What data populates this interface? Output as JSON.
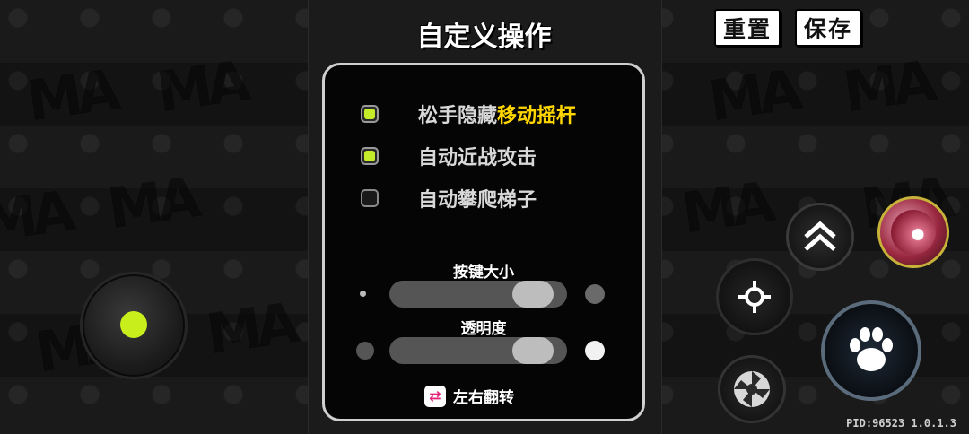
{
  "header": {
    "title": "自定义操作"
  },
  "toolbar": {
    "reset_label": "重置",
    "save_label": "保存"
  },
  "options": [
    {
      "label_main": "松手隐藏",
      "label_highlight": "移动摇杆",
      "checked": true
    },
    {
      "label_main": "自动近战攻击",
      "label_highlight": "",
      "checked": true
    },
    {
      "label_main": "自动攀爬梯子",
      "label_highlight": "",
      "checked": false
    }
  ],
  "sliders": {
    "size": {
      "label": "按键大小",
      "value": 0.9
    },
    "opacity": {
      "label": "透明度",
      "value": 0.9
    }
  },
  "flip": {
    "label": "左右翻转",
    "icon": "swap-arrows-icon"
  },
  "footer": {
    "pid": "PID:96523 1.0.1.3"
  },
  "colors": {
    "accent": "#c8ef1c",
    "highlight": "#ffd600",
    "flip_icon": "#e0257a"
  },
  "controls": {
    "joystick": "virtual-joystick",
    "jump_icon": "double-chevron-up-icon",
    "aim_icon": "crosshair-icon",
    "attack_icon": "paw-icon",
    "spin_icon": "shuriken-icon",
    "skill_icon": "character-skill-icon"
  }
}
